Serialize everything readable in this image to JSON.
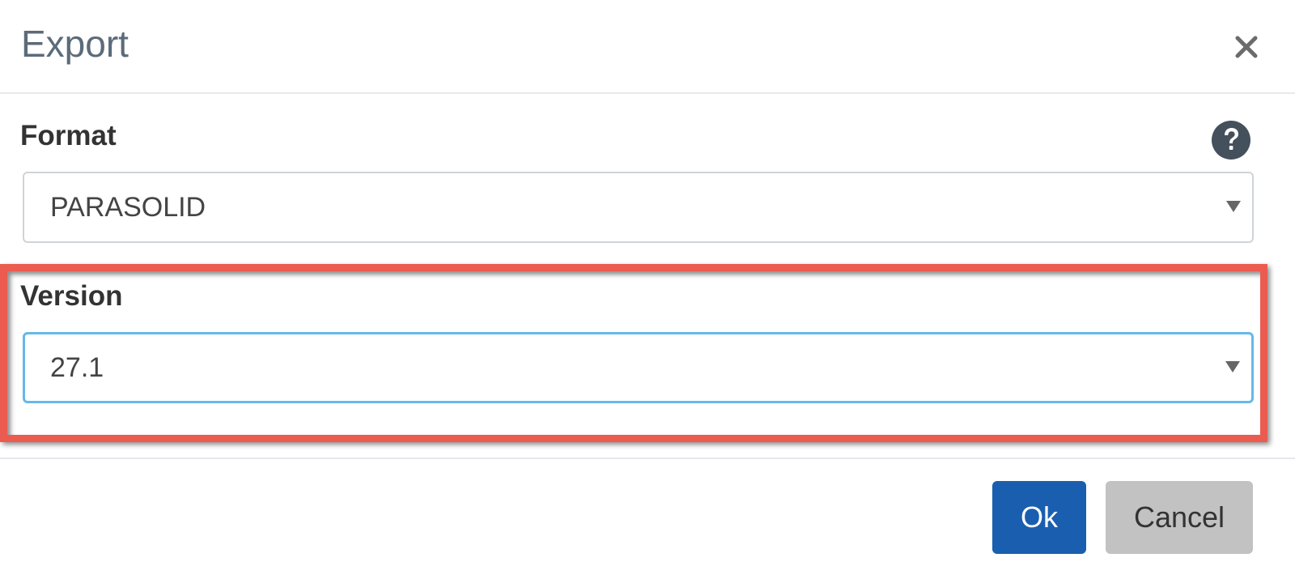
{
  "dialog": {
    "title": "Export",
    "close_label": "close"
  },
  "format": {
    "label": "Format",
    "selected": "PARASOLID"
  },
  "version": {
    "label": "Version",
    "selected": "27.1"
  },
  "buttons": {
    "ok": "Ok",
    "cancel": "Cancel"
  },
  "colors": {
    "primary_button": "#1a5faf",
    "secondary_button": "#c2c2c2",
    "highlight_border": "#ec5b50",
    "focus_border": "#66b8ea"
  },
  "icons": {
    "close": "close-icon",
    "help": "help-icon",
    "dropdown": "chevron-down-icon"
  }
}
